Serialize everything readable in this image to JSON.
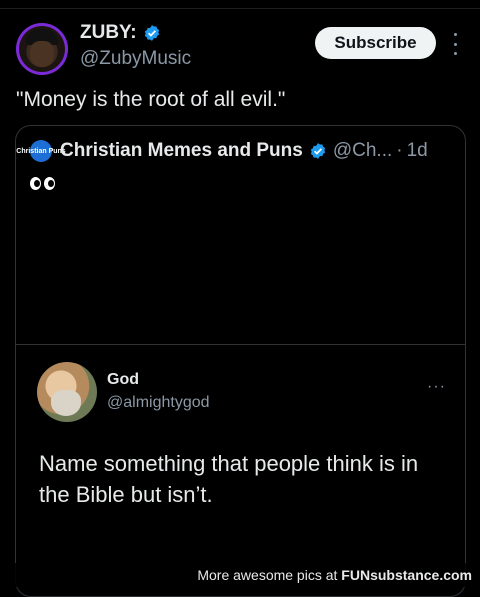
{
  "author": {
    "name": "ZUBY:",
    "handle": "@ZubyMusic",
    "subscribe_label": "Subscribe"
  },
  "tweet": {
    "text": "\"Money is the root of all evil.\""
  },
  "quoted": {
    "name": "Christian Memes and Puns",
    "handle": "@Ch...",
    "separator": "·",
    "time": "1d",
    "avatar_text": "Christian Puns",
    "emoji": "👀",
    "embedded": {
      "name": "God",
      "handle": "@almightygod",
      "more_label": "···",
      "text": "Name something that people think is in the Bible but isn’t."
    }
  },
  "footer": {
    "prefix": "More awesome pics at",
    "brand": "FUNsubstance.com"
  },
  "colors": {
    "background": "#000000",
    "verified": "#1d9bf0",
    "secondary_text": "#8b98a5",
    "border": "#2f3336"
  },
  "icons": [
    "verified-badge-icon",
    "more-vertical-icon",
    "more-horizontal-icon"
  ]
}
